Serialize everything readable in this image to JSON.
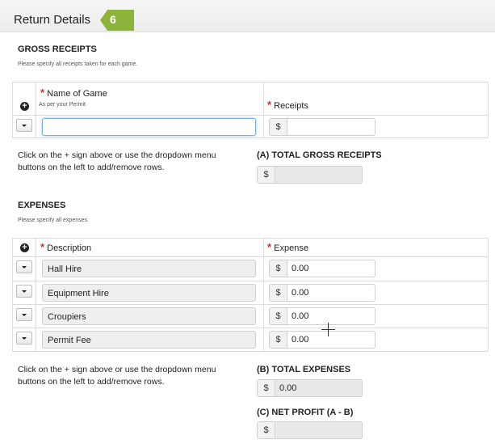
{
  "header": {
    "title": "Return Details",
    "step": "6"
  },
  "gross_receipts": {
    "title": "GROSS RECEIPTS",
    "subtitle": "Please specify all receipts taken for each game.",
    "add_icon": "plus-circle-icon",
    "columns": {
      "name": {
        "required": "*",
        "label": "Name of Game",
        "sub": "As per your Permit"
      },
      "receipts": {
        "required": "*",
        "label": "Receipts"
      }
    },
    "rows": [
      {
        "name": "",
        "currency": "$",
        "receipts": ""
      }
    ],
    "help": "Click on the + sign above or use the dropdown menu buttons on the left to add/remove rows.",
    "total_label": "(A) TOTAL GROSS RECEIPTS",
    "total_currency": "$",
    "total_value": ""
  },
  "expenses": {
    "title": "EXPENSES",
    "subtitle": "Please specify all expenses.",
    "add_icon": "plus-circle-icon",
    "columns": {
      "description": {
        "required": "*",
        "label": "Description"
      },
      "expense": {
        "required": "*",
        "label": "Expense"
      }
    },
    "rows": [
      {
        "description": "Hall Hire",
        "currency": "$",
        "expense": "0.00"
      },
      {
        "description": "Equipment Hire",
        "currency": "$",
        "expense": "0.00"
      },
      {
        "description": "Croupiers",
        "currency": "$",
        "expense": "0.00"
      },
      {
        "description": "Permit Fee",
        "currency": "$",
        "expense": "0.00"
      }
    ],
    "help": "Click on the + sign above or use the dropdown menu buttons on the left to add/remove rows.",
    "total_label": "(B) TOTAL EXPENSES",
    "total_currency": "$",
    "total_value": "0.00"
  },
  "net_profit": {
    "label": "(C) NET PROFIT (A - B)",
    "currency": "$",
    "value": ""
  },
  "colors": {
    "accent": "#8cb43c",
    "required": "#c0392b",
    "focus": "#7bb0e0"
  }
}
